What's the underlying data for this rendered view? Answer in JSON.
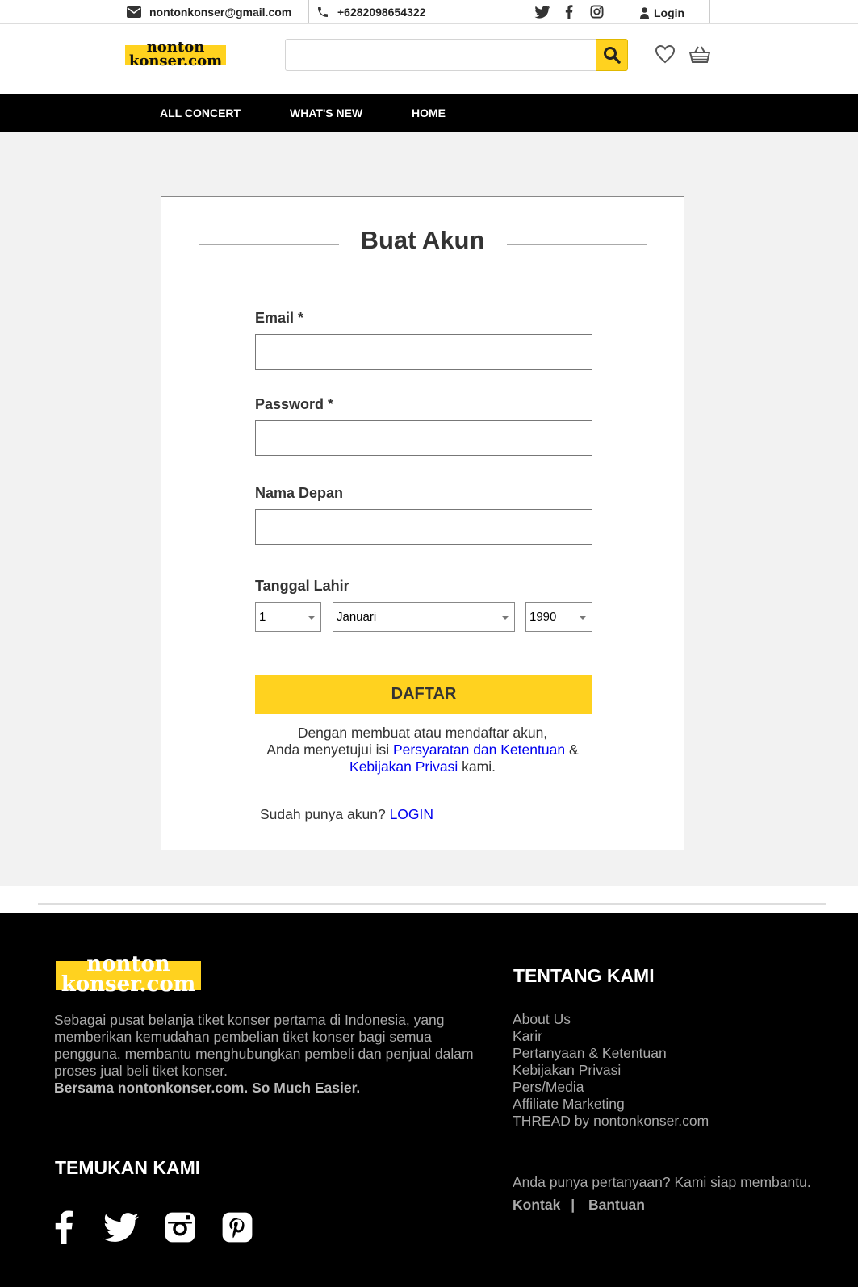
{
  "topbar": {
    "email": "nontonkonser@gmail.com",
    "phone": "+6282098654322",
    "login_label": "Login",
    "icons": [
      "envelope-icon",
      "phone-icon",
      "twitter-icon",
      "facebook-icon",
      "instagram-icon",
      "user-icon"
    ]
  },
  "brand": {
    "logo_line1": "nonton",
    "logo_line2": "konser.com",
    "accent_color": "#ffd21f"
  },
  "header": {
    "search_placeholder": "",
    "icons": [
      "search-icon",
      "heart-icon",
      "basket-icon"
    ]
  },
  "nav": {
    "items": [
      "ALL CONCERT",
      "WHAT'S NEW",
      "HOME"
    ]
  },
  "form": {
    "title": "Buat Akun",
    "email_label": "Email *",
    "email_value": "",
    "password_label": "Password *",
    "password_value": "",
    "first_name_label": "Nama Depan",
    "first_name_value": "",
    "birthdate_label": "Tanggal Lahir",
    "day_value": "1",
    "month_value": "Januari",
    "year_value": "1990",
    "submit_label": "DAFTAR",
    "terms_line1": "Dengan membuat atau mendaftar akun,",
    "terms_line2_pre": "Anda menyetujui isi",
    "terms_link": "Persyaratan dan Ketentuan",
    "terms_line2_post": "&",
    "privacy_link": "Kebijakan Privasi",
    "terms_line3_post": "kami.",
    "have_account": "Sudah punya akun?",
    "login_link": "LOGIN",
    "link_color": "#0000ee"
  },
  "footer": {
    "about_text": "Sebagai pusat belanja tiket konser pertama di Indonesia, yang memberikan kemudahan pembelian tiket konser bagi semua pengguna. membantu menghubungkan pembeli dan penjual dalam proses jual beli tiket konser.",
    "about_tagline": "Bersama nontonkonser.com. So Much Easier.",
    "find_us_heading": "TEMUKAN KAMI",
    "about_heading": "TENTANG KAMI",
    "links": [
      "About Us",
      "Karir",
      "Pertanyaan & Ketentuan",
      "Kebijakan Privasi",
      "Pers/Media",
      "Affiliate Marketing",
      "THREAD by nontonkonser.com"
    ],
    "question": "Anda punya pertanyaan? Kami siap membantu.",
    "contact_label": "Kontak",
    "contact_sep": "|",
    "help_label": "Bantuan",
    "social_icons": [
      "facebook-icon",
      "twitter-icon",
      "instagram-icon",
      "pinterest-icon"
    ]
  }
}
